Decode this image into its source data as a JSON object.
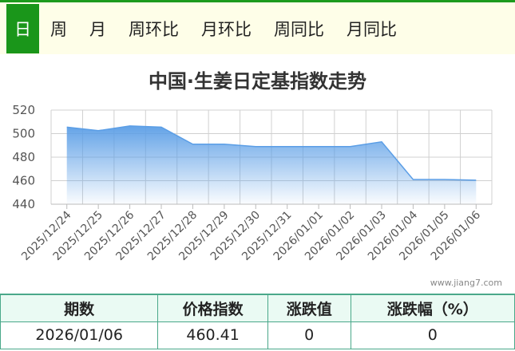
{
  "tabs": [
    {
      "label": "日",
      "active": true
    },
    {
      "label": "周",
      "active": false
    },
    {
      "label": "月",
      "active": false
    },
    {
      "label": "周环比",
      "active": false
    },
    {
      "label": "月环比",
      "active": false
    },
    {
      "label": "周同比",
      "active": false
    },
    {
      "label": "月同比",
      "active": false
    }
  ],
  "colors": {
    "accent": "#1a961a",
    "series": "#5b9ee6",
    "grid": "#d0d0d0"
  },
  "chart_data": {
    "type": "area",
    "title": "中国·生姜日定基指数走势",
    "xlabel": "",
    "ylabel": "",
    "ylim": [
      440,
      520
    ],
    "yticks": [
      440,
      460,
      480,
      500,
      520
    ],
    "grid": true,
    "legend": "none",
    "categories": [
      "2025/12/24",
      "2025/12/25",
      "2025/12/26",
      "2025/12/27",
      "2025/12/28",
      "2025/12/29",
      "2025/12/30",
      "2025/12/31",
      "2026/01/01",
      "2026/01/02",
      "2026/01/03",
      "2026/01/04",
      "2026/01/05",
      "2026/01/06"
    ],
    "series": [
      {
        "values": [
          505.5,
          502.5,
          506.5,
          505.5,
          491,
          491,
          489,
          489,
          489,
          489,
          493,
          461,
          461,
          460.41
        ]
      }
    ]
  },
  "watermark": "www.jiang7.com",
  "table": {
    "headers": [
      "期数",
      "价格指数",
      "涨跌值",
      "涨跌幅（%）"
    ],
    "row": [
      "2026/01/06",
      "460.41",
      "0",
      "0"
    ]
  }
}
